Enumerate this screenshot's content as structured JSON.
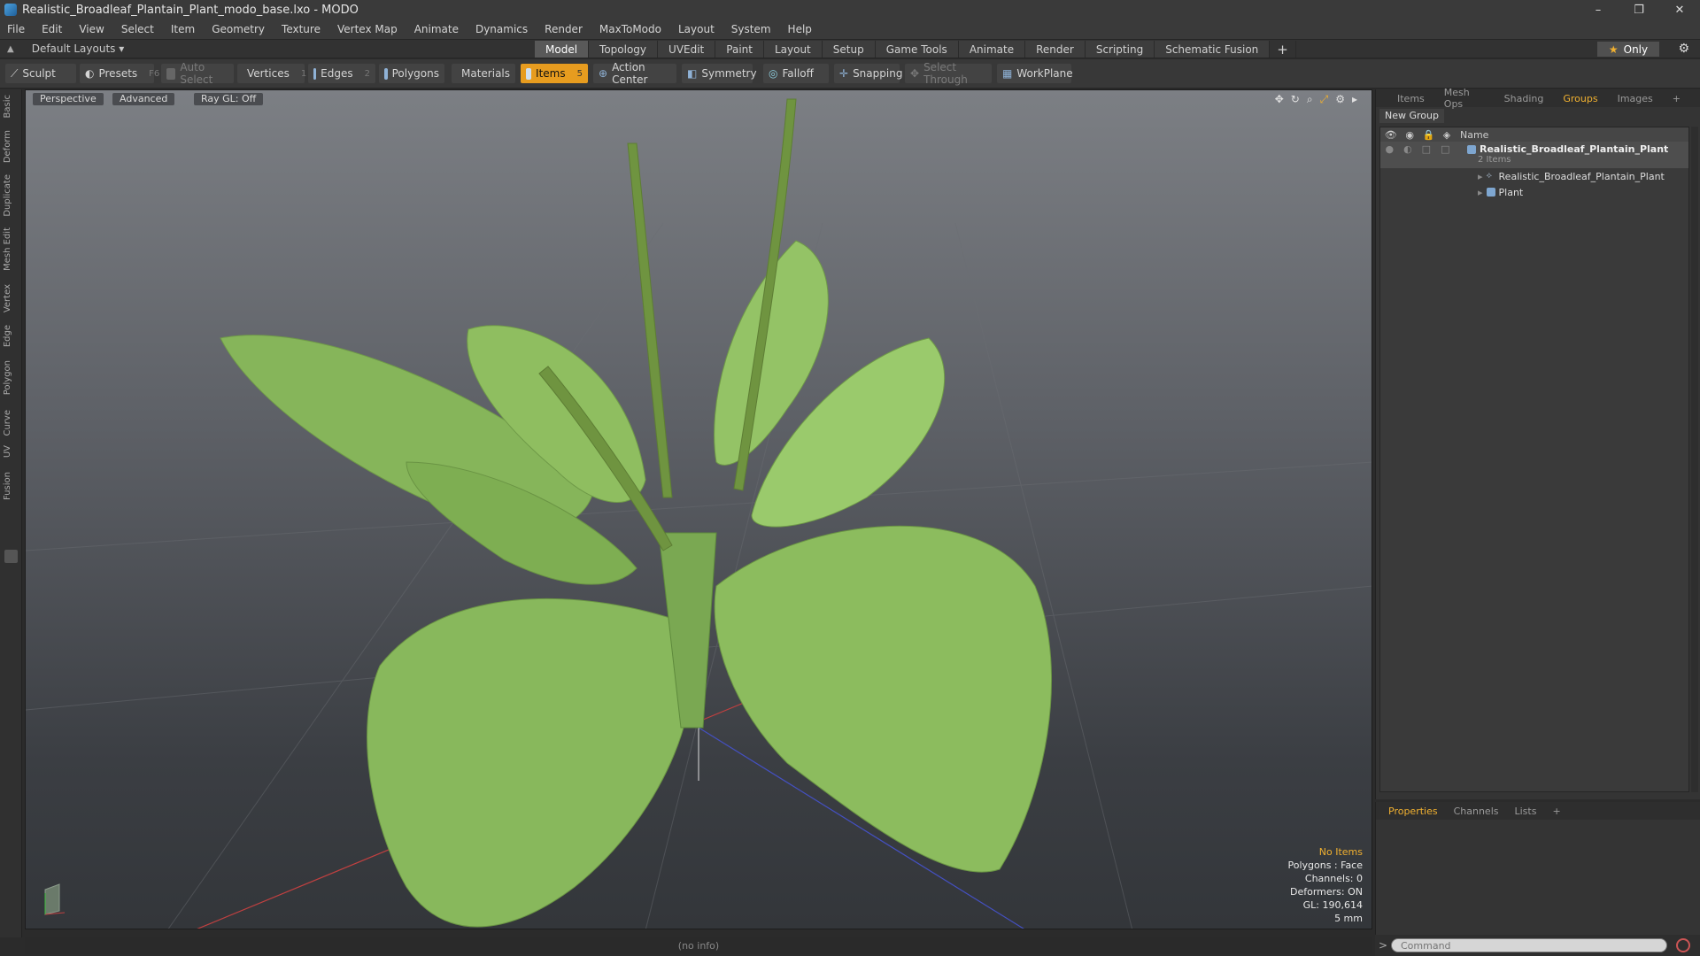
{
  "window": {
    "title": "Realistic_Broadleaf_Plantain_Plant_modo_base.lxo - MODO",
    "controls": [
      "–",
      "❐",
      "✕"
    ]
  },
  "menu": [
    "File",
    "Edit",
    "View",
    "Select",
    "Item",
    "Geometry",
    "Texture",
    "Vertex Map",
    "Animate",
    "Dynamics",
    "Render",
    "MaxToModo",
    "Layout",
    "System",
    "Help"
  ],
  "layout": {
    "selector": "Default Layouts ▾",
    "tabs": [
      "Model",
      "Topology",
      "UVEdit",
      "Paint",
      "Layout",
      "Setup",
      "Game Tools",
      "Animate",
      "Render",
      "Scripting",
      "Schematic Fusion"
    ],
    "active_tab": "Model",
    "only_label": "Only"
  },
  "toolbar": {
    "sculpt": "Sculpt",
    "presets": "Presets",
    "presets_key": "F6",
    "auto_select": "Auto Select",
    "vertices": "Vertices",
    "vertices_key": "1",
    "edges": "Edges",
    "edges_key": "2",
    "polygons": "Polygons",
    "materials": "Materials",
    "items": "Items",
    "items_key": "5",
    "action_center": "Action Center",
    "symmetry": "Symmetry",
    "falloff": "Falloff",
    "snapping": "Snapping",
    "select_through": "Select Through",
    "workplane": "WorkPlane"
  },
  "left_tabs": [
    "Basic",
    "Deform",
    "Duplicate",
    "Mesh Edit",
    "Vertex",
    "Edge",
    "Polygon",
    "Curve",
    "UV",
    "Fusion"
  ],
  "viewport": {
    "view": "Perspective",
    "mode": "Advanced",
    "raygl": "Ray GL: Off",
    "info": {
      "items": "No Items",
      "polygons": "Polygons : Face",
      "channels": "Channels: 0",
      "deformers": "Deformers: ON",
      "gl": "GL: 190,614",
      "scale": "5 mm"
    }
  },
  "status": "(no info)",
  "right_panel": {
    "tabs": [
      "Items",
      "Mesh Ops",
      "Shading",
      "Groups",
      "Images"
    ],
    "active_tab": "Groups",
    "new_group": "New Group",
    "name_col": "Name",
    "group_name": "Realistic_Broadleaf_Plantain_Plant",
    "group_count": "2 Items",
    "child1": "Realistic_Broadleaf_Plantain_Plant",
    "child2": "Plant"
  },
  "properties_panel": {
    "tabs": [
      "Properties",
      "Channels",
      "Lists"
    ],
    "active_tab": "Properties"
  },
  "command": {
    "placeholder": "Command"
  }
}
